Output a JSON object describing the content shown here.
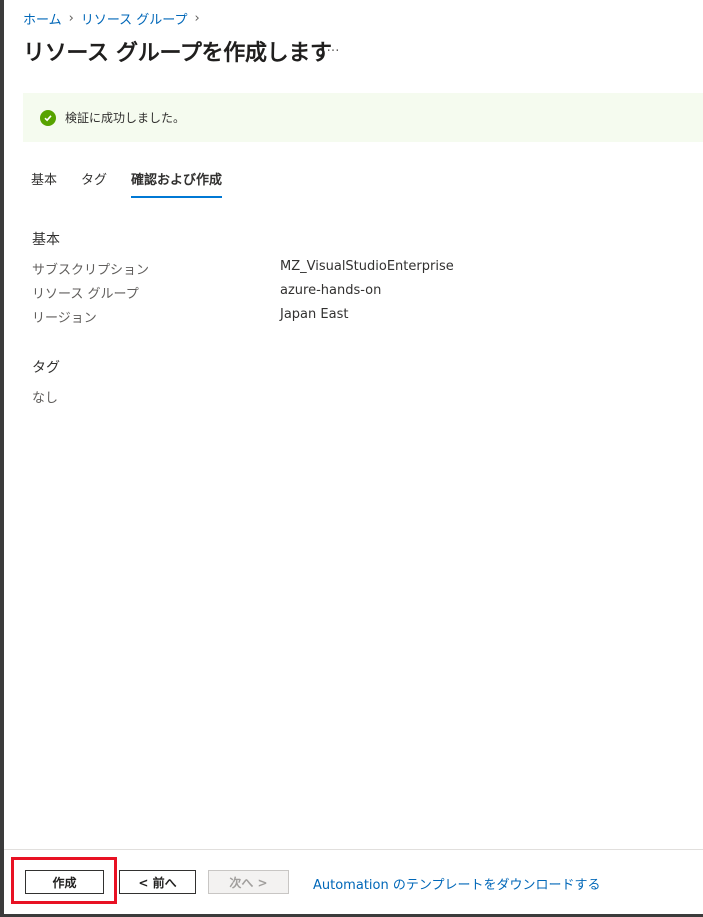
{
  "breadcrumb": {
    "items": [
      "ホーム",
      "リソース グループ"
    ]
  },
  "page": {
    "title": "リソース グループを作成します",
    "more_label": "…"
  },
  "banner": {
    "message": "検証に成功しました。",
    "icon": "check-circle-icon",
    "color": "#57a300"
  },
  "tabs": [
    {
      "label": "基本",
      "active": false
    },
    {
      "label": "タグ",
      "active": false
    },
    {
      "label": "確認および作成",
      "active": true
    }
  ],
  "summary": {
    "basics": {
      "title": "基本",
      "rows": [
        {
          "label": "サブスクリプション",
          "value": "MZ_VisualStudioEnterprise"
        },
        {
          "label": "リソース グループ",
          "value": "azure-hands-on"
        },
        {
          "label": "リージョン",
          "value": "Japan East"
        }
      ]
    },
    "tags": {
      "title": "タグ",
      "empty": "なし"
    }
  },
  "footer": {
    "create_label": "作成",
    "prev_label": "< 前へ",
    "next_label": "次へ >",
    "download_link": "Automation のテンプレートをダウンロードする"
  },
  "colors": {
    "accent": "#0078d4",
    "link": "#0067b8",
    "success": "#57a300",
    "highlight": "#e81123"
  }
}
